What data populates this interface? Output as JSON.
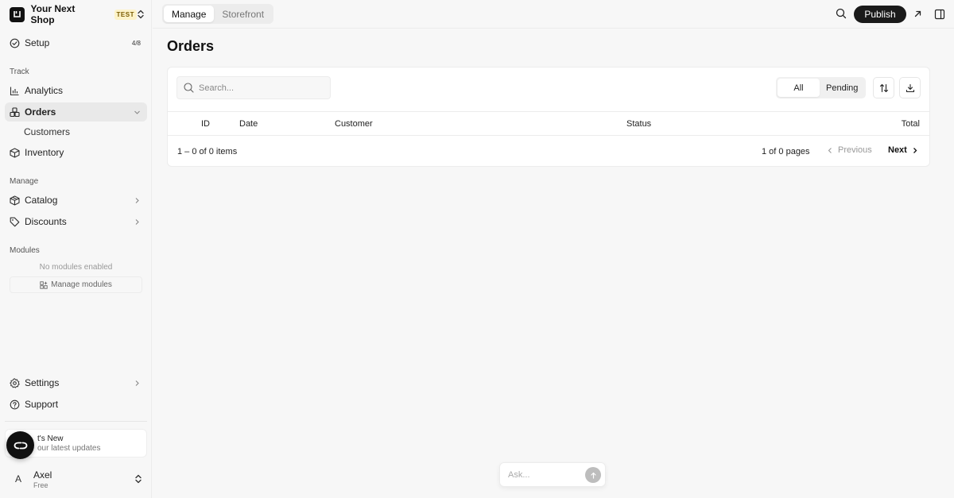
{
  "brand": {
    "name": "Your Next Shop",
    "badge": "TEST"
  },
  "sidebar": {
    "setup": {
      "label": "Setup",
      "progress": "4/8"
    },
    "sections": {
      "track": "Track",
      "manage": "Manage",
      "modules": "Modules"
    },
    "track_items": [
      {
        "label": "Analytics",
        "icon": "bar-chart-icon"
      },
      {
        "label": "Orders",
        "icon": "orders-icon",
        "active": true
      },
      {
        "label": "Customers"
      },
      {
        "label": "Inventory",
        "icon": "box-icon"
      }
    ],
    "manage_items": [
      {
        "label": "Catalog",
        "icon": "package-icon"
      },
      {
        "label": "Discounts",
        "icon": "tag-icon"
      }
    ],
    "modules_empty": "No modules enabled",
    "manage_modules": "Manage modules",
    "settings": "Settings",
    "support": "Support",
    "whats_new": {
      "title": "t's New",
      "subtitle": " our latest updates"
    },
    "user": {
      "initial": "A",
      "name": "Axel",
      "plan": "Free"
    }
  },
  "topbar": {
    "tabs": [
      {
        "label": "Manage",
        "active": true
      },
      {
        "label": "Storefront",
        "active": false
      }
    ],
    "publish": "Publish"
  },
  "main": {
    "title": "Orders",
    "search_placeholder": "Search...",
    "filters": [
      {
        "label": "All",
        "active": true
      },
      {
        "label": "Pending",
        "active": false
      }
    ],
    "columns": [
      "ID",
      "Date",
      "Customer",
      "Status",
      "Total"
    ],
    "rows": [],
    "pagination": {
      "items": "1 – 0 of 0 items",
      "pages": "1 of 0 pages",
      "previous": "Previous",
      "next": "Next"
    }
  },
  "ask": {
    "placeholder": "Ask..."
  }
}
